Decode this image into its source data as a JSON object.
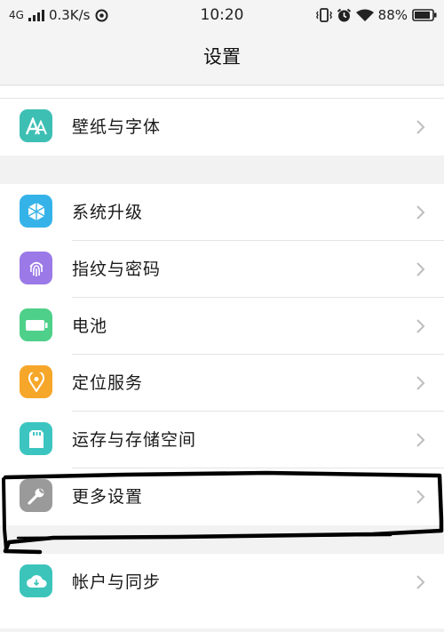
{
  "status_bar": {
    "network": "4G",
    "speed": "0.3K/s",
    "time": "10:20",
    "battery": "88%"
  },
  "header": {
    "title": "设置"
  },
  "settings": {
    "items": [
      {
        "label": "壁纸与字体",
        "icon": "font-icon",
        "color": "#3ebfb4"
      },
      {
        "label": "系统升级",
        "icon": "upgrade-icon",
        "color": "#35b3e8"
      },
      {
        "label": "指纹与密码",
        "icon": "fingerprint-icon",
        "color": "#9b79e6"
      },
      {
        "label": "电池",
        "icon": "battery-icon",
        "color": "#4fd08a"
      },
      {
        "label": "定位服务",
        "icon": "location-icon",
        "color": "#f6a72a"
      },
      {
        "label": "运存与存储空间",
        "icon": "storage-icon",
        "color": "#3cc5c0"
      },
      {
        "label": "更多设置",
        "icon": "wrench-icon",
        "color": "#9a9a9a"
      },
      {
        "label": "帐户与同步",
        "icon": "cloud-icon",
        "color": "#3cc4bb"
      }
    ]
  },
  "colors": {
    "background": "#f2f2f2",
    "row": "#ffffff",
    "chevron": "#bdbdbd",
    "annotation_stroke": "#000000"
  }
}
